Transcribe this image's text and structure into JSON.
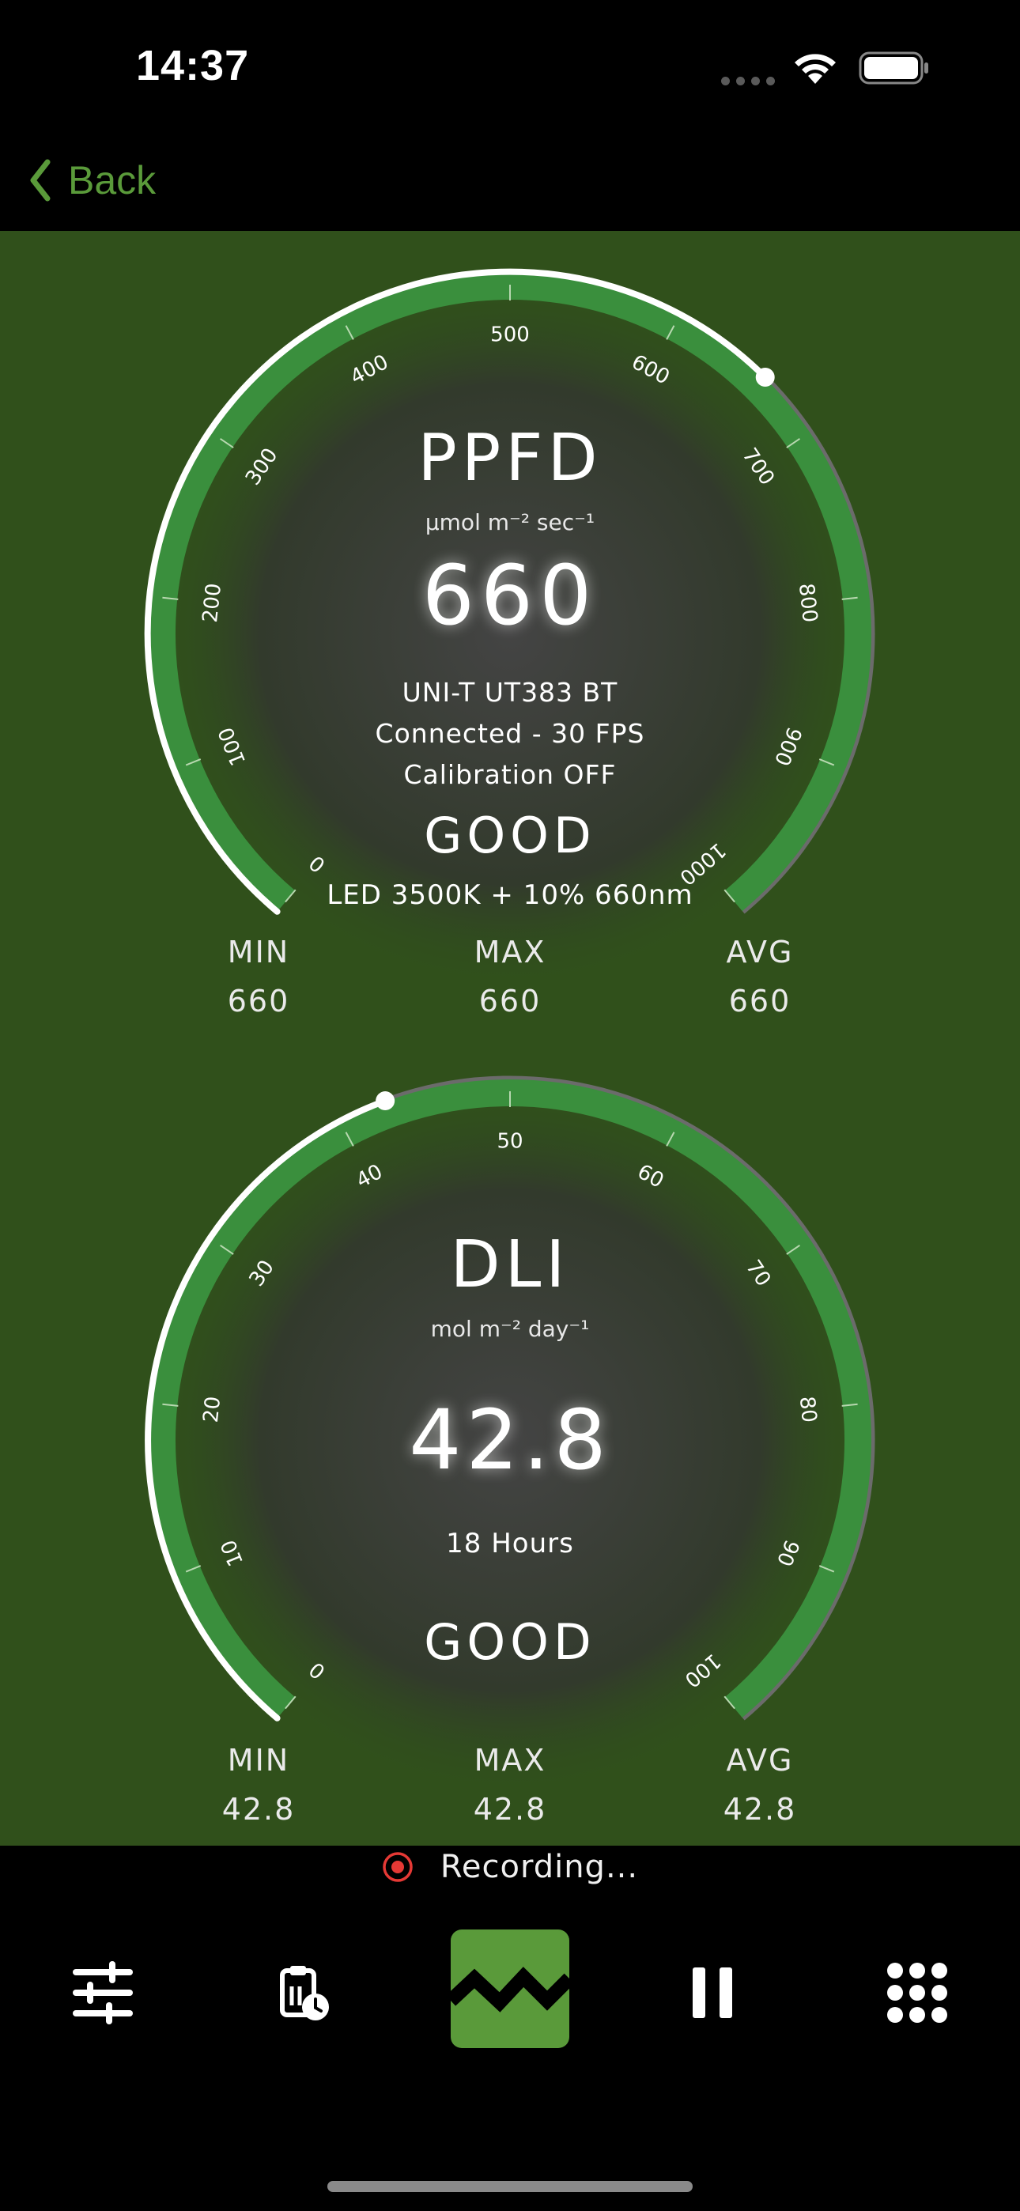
{
  "status_bar": {
    "time": "14:37"
  },
  "nav": {
    "back_label": "Back"
  },
  "colors": {
    "accent": "#5a9a3a",
    "background": "#30501b",
    "arc": "#3a8f3d",
    "recording": "#e53935"
  },
  "ppfd": {
    "title": "PPFD",
    "unit": "μmol m⁻² sec⁻¹",
    "value": "660",
    "device": "UNI-T UT383 BT",
    "connection": "Connected - 30 FPS",
    "calibration": "Calibration OFF",
    "rating": "GOOD",
    "light_source": "LED 3500K + 10% 660nm",
    "scale_min": 0,
    "scale_max": 1000,
    "reading": 660,
    "ticks": [
      "0",
      "100",
      "200",
      "300",
      "400",
      "500",
      "600",
      "700",
      "800",
      "900",
      "1000"
    ],
    "stats": {
      "min_label": "MIN",
      "min": "660",
      "max_label": "MAX",
      "max": "660",
      "avg_label": "AVG",
      "avg": "660"
    }
  },
  "dli": {
    "title": "DLI",
    "unit": "mol m⁻² day⁻¹",
    "value": "42.8",
    "hours": "18 Hours",
    "rating": "GOOD",
    "scale_min": 0,
    "scale_max": 100,
    "reading": 42.8,
    "ticks": [
      "0",
      "10",
      "20",
      "30",
      "40",
      "50",
      "60",
      "70",
      "80",
      "90",
      "100"
    ],
    "stats": {
      "min_label": "MIN",
      "min": "42.8",
      "max_label": "MAX",
      "max": "42.8",
      "avg_label": "AVG",
      "avg": "42.8"
    }
  },
  "recording": {
    "label": "Recording..."
  },
  "toolbar": {
    "settings_icon": "sliders-icon",
    "history_icon": "clipboard-clock-icon",
    "chart_icon": "zigzag-chart-icon",
    "pause_icon": "pause-icon",
    "menu_icon": "grid-dots-icon"
  }
}
